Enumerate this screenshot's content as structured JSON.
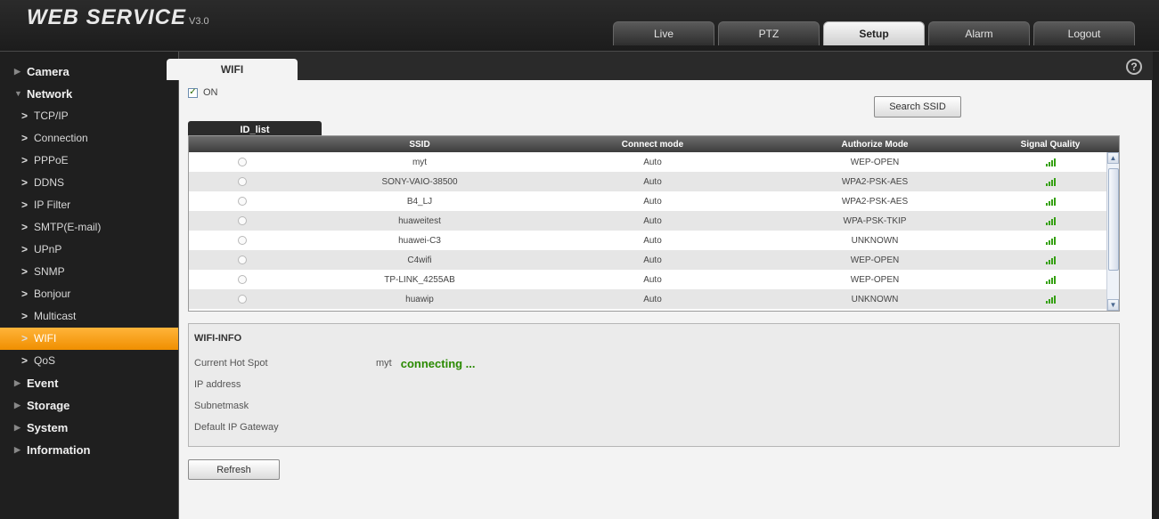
{
  "header": {
    "brand": "WEB  SERVICE",
    "version": "V3.0",
    "tabs": [
      {
        "label": "Live",
        "active": false
      },
      {
        "label": "PTZ",
        "active": false
      },
      {
        "label": "Setup",
        "active": true
      },
      {
        "label": "Alarm",
        "active": false
      },
      {
        "label": "Logout",
        "active": false
      }
    ]
  },
  "sidebar": {
    "items": [
      {
        "label": "Camera",
        "level": "top"
      },
      {
        "label": "Network",
        "level": "top"
      },
      {
        "label": "TCP/IP",
        "level": "sub"
      },
      {
        "label": "Connection",
        "level": "sub"
      },
      {
        "label": "PPPoE",
        "level": "sub"
      },
      {
        "label": "DDNS",
        "level": "sub"
      },
      {
        "label": "IP Filter",
        "level": "sub"
      },
      {
        "label": "SMTP(E-mail)",
        "level": "sub"
      },
      {
        "label": "UPnP",
        "level": "sub"
      },
      {
        "label": "SNMP",
        "level": "sub"
      },
      {
        "label": "Bonjour",
        "level": "sub"
      },
      {
        "label": "Multicast",
        "level": "sub"
      },
      {
        "label": "WIFI",
        "level": "sub",
        "active": true
      },
      {
        "label": "QoS",
        "level": "sub"
      },
      {
        "label": "Event",
        "level": "top"
      },
      {
        "label": "Storage",
        "level": "top"
      },
      {
        "label": "System",
        "level": "top"
      },
      {
        "label": "Information",
        "level": "top"
      }
    ]
  },
  "content": {
    "tab_label": "WIFI",
    "help_icon": "?",
    "on_label": "ON",
    "on_checked": true,
    "search_button": "Search SSID",
    "idlist_label": "ID_list",
    "columns": [
      "",
      "SSID",
      "Connect mode",
      "Authorize Mode",
      "Signal Quality"
    ],
    "rows": [
      {
        "ssid": "myt",
        "connect": "Auto",
        "auth": "WEP-OPEN"
      },
      {
        "ssid": "SONY-VAIO-38500",
        "connect": "Auto",
        "auth": "WPA2-PSK-AES"
      },
      {
        "ssid": "B4_LJ",
        "connect": "Auto",
        "auth": "WPA2-PSK-AES"
      },
      {
        "ssid": "huaweitest",
        "connect": "Auto",
        "auth": "WPA-PSK-TKIP"
      },
      {
        "ssid": "huawei-C3",
        "connect": "Auto",
        "auth": "UNKNOWN"
      },
      {
        "ssid": "C4wifi",
        "connect": "Auto",
        "auth": "WEP-OPEN"
      },
      {
        "ssid": "TP-LINK_4255AB",
        "connect": "Auto",
        "auth": "WEP-OPEN"
      },
      {
        "ssid": "huawip",
        "connect": "Auto",
        "auth": "UNKNOWN"
      }
    ],
    "signal_color": "#35a012",
    "wifi_info": {
      "title": "WIFI-INFO",
      "current_hotspot_label": "Current Hot Spot",
      "current_hotspot_value": "myt",
      "status": "connecting ...",
      "ip_label": "IP address",
      "subnet_label": "Subnetmask",
      "gateway_label": "Default IP Gateway"
    },
    "refresh_button": "Refresh"
  }
}
